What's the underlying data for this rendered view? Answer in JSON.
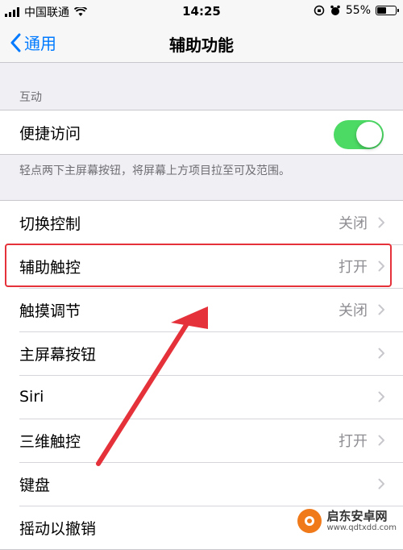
{
  "status_bar": {
    "carrier": "中国联通",
    "time": "14:25",
    "battery_percent": "55%",
    "battery_level": 0.55
  },
  "nav": {
    "back_label": "通用",
    "title": "辅助功能"
  },
  "sections": {
    "interaction_header": "互动",
    "reachability_label": "便捷访问",
    "reachability_on": true,
    "reachability_note": "轻点两下主屏幕按钮，将屏幕上方项目拉至可及范围。"
  },
  "rows": [
    {
      "label": "切换控制",
      "detail": "关闭"
    },
    {
      "label": "辅助触控",
      "detail": "打开"
    },
    {
      "label": "触摸调节",
      "detail": "关闭"
    },
    {
      "label": "主屏幕按钮",
      "detail": ""
    },
    {
      "label": "Siri",
      "detail": ""
    },
    {
      "label": "三维触控",
      "detail": "打开"
    },
    {
      "label": "键盘",
      "detail": ""
    },
    {
      "label": "摇动以撤销",
      "detail": ""
    }
  ],
  "colors": {
    "accent": "#007aff",
    "toggle_on": "#4cd964",
    "annotation": "#e5323a"
  },
  "watermark": {
    "title": "启东安卓网",
    "url": "www.qdtxdd.com"
  }
}
